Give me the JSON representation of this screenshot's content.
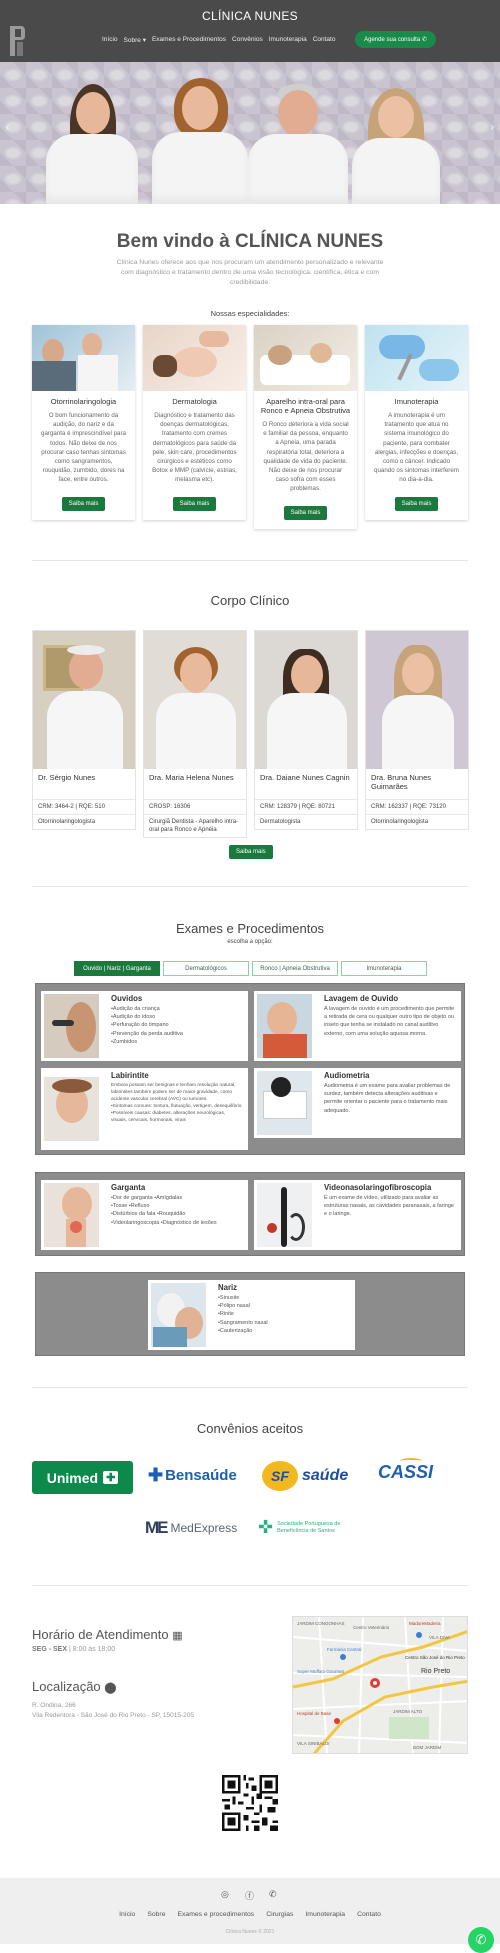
{
  "nav": {
    "brand": "CLÍNICA NUNES",
    "links": [
      "Início",
      "Sobre ▾",
      "Exames e Procedimentos",
      "Convênios",
      "Imunoterapia",
      "Contato"
    ],
    "cta": "Agende sua consulta ✆"
  },
  "welcome": {
    "title": "Bem vindo à CLÍNICA NUNES",
    "intro": "Clínica Nunes oferece aos que nos procuram um atendimento personalizado e relevante com diagnóstico e tratamento dentro de uma visão tecnológica, científica, ética e com credibilidade.",
    "specialties_title": "Nossas especialidades:"
  },
  "specialties": [
    {
      "title": "Otorrinolaringologia",
      "desc": "O bom funcionamento da audição, do nariz e da garganta é imprescindível para todos. Não deixe de nos procurar caso tenhas sintomas como sangramentos, rouquidão, zumbido, dores na face, entre outros.",
      "button": "Saiba mais"
    },
    {
      "title": "Dermatologia",
      "desc": "Diagnóstico e tratamento das doenças dermatológicas, tratamento com cremes dermatológicos para saúde da pele, skin care, procedimentos cirúrgicos e estéticos como Botox e MMP (calvície, estrias, melasma etc).",
      "button": "Saiba mais"
    },
    {
      "title": "Aparelho intra-oral para Ronco e Apneia Obstrutiva",
      "desc": "O Ronco deteriora a vida social e familiar da pessoa, enquanto a Apneia, uma parada respiratória total, deteriora a qualidade de vida do paciente. Não deixe de nos procurar caso sofra com esses problemas.",
      "button": "Saiba mais"
    },
    {
      "title": "Imunoterapia",
      "desc": "A imunoterapia é um tratamento que atua no sistema imunológico do paciente, para combater alergias, infecções e doenças, como o câncer. Indicado quando os sintomas interferem no dia-a-dia.",
      "button": "Saiba mais"
    }
  ],
  "corpo": {
    "title": "Corpo Clínico",
    "button": "Saiba mais",
    "doctors": [
      {
        "name": "Dr. Sérgio Nunes",
        "reg": "CRM: 3464-2 | RQE: 510",
        "spec": "Otorrinolaringologista"
      },
      {
        "name": "Dra. Maria Helena Nunes",
        "reg": "CROSP: 16306",
        "spec": "Cirurgiã Dentista - Aparelho intra-oral para Ronco e Apnéia"
      },
      {
        "name": "Dra. Daiane Nunes Cagnin",
        "reg": "CRM: 128379 | RQE: 80721",
        "spec": "Dermatologista"
      },
      {
        "name": "Dra. Bruna Nunes Guimarães",
        "reg": "CRM: 162337 | RQE: 73120",
        "spec": "Otorrinolaringologista"
      }
    ]
  },
  "exams": {
    "title": "Exames e Procedimentos",
    "subtitle": "escolha a opção:",
    "tabs": [
      "Ouvido | Nariz | Garganta",
      "Dermatológicos",
      "Ronco | Apneia Obstrutiva",
      "Imunoterapia"
    ],
    "cards": {
      "ouvidos": {
        "title": "Ouvidos",
        "text": "•Audição da criança\n•Audição do idoso\n•Perfuração do timpano\n•Prevenção da perda auditiva\n•Zumbidos"
      },
      "lavagem": {
        "title": "Lavagem de Ouvido",
        "text": "A lavagem de ouvido é um procedimento que permite a retirada de cera ou qualquer outro tipo de objeto ou inseto que tenha se instalado no canal auditivo externo, com uma solução aquosa morna."
      },
      "labirintite": {
        "title": "Labirintite",
        "text": "Embora possam ser benignas e tenham resolução natural, labirintites também podem ser de maior gravidade, como acidente vascular cerebral (AVC) ou tumores.\n•Sintomas comuns: tontura, flutuação, vertigem, desequilíbrio\n•Possíveis causas: diabetes, alterações neurológicas, visuais, cervicais, hormonais, virais"
      },
      "audiometria": {
        "title": "Audiometria",
        "text": "Audiometria é um exame para avaliar problemas de surdez, também detecta alterações auditivas e permite orientar o paciente para o tratamento mais adequado."
      },
      "garganta": {
        "title": "Garganta",
        "text": "•Dor de garganta •Amígdalas\n•Tosse •Refluxo\n•Distúrbios da fala •Rouquidão\n•Videolaringoscopia •Diagnóstico de lesões"
      },
      "video": {
        "title": "Videonasolaringofibroscopia",
        "text": "É um exame de vídeo, utilizado para avaliar as estruturas nasais, as cavidades paranasais, a faringe e o laringe."
      },
      "nariz": {
        "title": "Nariz",
        "text": "•Sinusite\n•Pólipo nasal\n•Rinite\n•Sangramento nasal\n•Cauterização"
      }
    }
  },
  "convenios": {
    "title": "Convênios aceitos",
    "logos": [
      "Unimed",
      "Bensaúde",
      "saúde",
      "CASSI",
      "MedExpress",
      "Sociedade Portuguesa de Beneficência de Santos"
    ]
  },
  "contact": {
    "hours_title": "Horário de Atendimento",
    "hours_days": "SEG - SEX",
    "hours_time": "| 8:00 às 18:00",
    "loc_title": "Localização",
    "addr1": "R. Ondina, 266",
    "addr2": "Vila Redentora - São José do Rio Preto - SP, 15015-205"
  },
  "map": {
    "labels": [
      "JARDIM CONGONHAS",
      "Centro Veterinário",
      "MadureMadeira",
      "VILA DIVA",
      "Farmácia Central",
      "Centro São José do Rio Preto",
      "Super Muffato Gourmet",
      "Rio Preto",
      "Hospital de Base",
      "JARDIM ALTO",
      "VILA SINIBALDI",
      "BOM JARDIM"
    ]
  },
  "footer": {
    "links": [
      "Início",
      "Sobre",
      "Exames e procedimentos",
      "Cirurgias",
      "Imunoterapia",
      "Contato"
    ],
    "copy": "Clínica Nunes © 2021"
  }
}
